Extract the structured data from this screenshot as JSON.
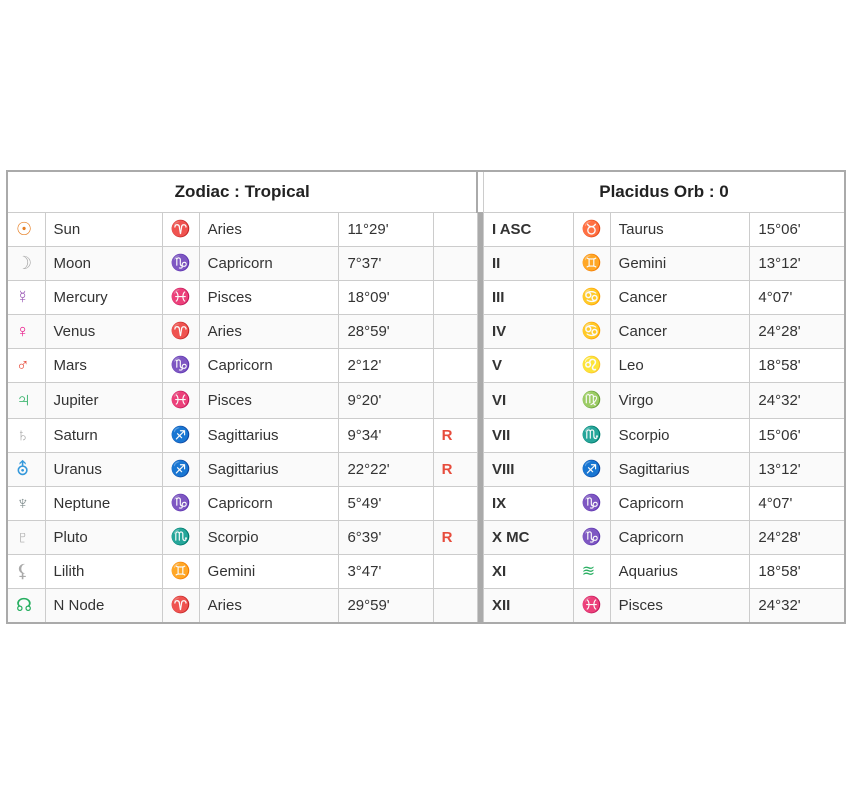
{
  "headers": {
    "left": "Zodiac : Tropical",
    "right": "Placidus Orb : 0"
  },
  "planets": [
    {
      "symbol": "☉",
      "sym_class": "sun-sym",
      "name": "Sun",
      "sign_sym": "♈",
      "sign_sym_class": "aries-sym",
      "sign": "Aries",
      "degree": "11°29'",
      "retro": ""
    },
    {
      "symbol": "☽",
      "sym_class": "moon-sym",
      "name": "Moon",
      "sign_sym": "♑",
      "sign_sym_class": "capricorn-sym",
      "sign": "Capricorn",
      "degree": "7°37'",
      "retro": ""
    },
    {
      "symbol": "☿",
      "sym_class": "mercury-sym",
      "name": "Mercury",
      "sign_sym": "♓",
      "sign_sym_class": "pisces-sym",
      "sign": "Pisces",
      "degree": "18°09'",
      "retro": ""
    },
    {
      "symbol": "♀",
      "sym_class": "venus-sym",
      "name": "Venus",
      "sign_sym": "♈",
      "sign_sym_class": "aries-sym",
      "sign": "Aries",
      "degree": "28°59'",
      "retro": ""
    },
    {
      "symbol": "♂",
      "sym_class": "mars-sym",
      "name": "Mars",
      "sign_sym": "♑",
      "sign_sym_class": "capricorn-sym",
      "sign": "Capricorn",
      "degree": "2°12'",
      "retro": ""
    },
    {
      "symbol": "♃",
      "sym_class": "jupiter-sym",
      "name": "Jupiter",
      "sign_sym": "♓",
      "sign_sym_class": "pisces-sym",
      "sign": "Pisces",
      "degree": "9°20'",
      "retro": ""
    },
    {
      "symbol": "♄",
      "sym_class": "saturn-sym",
      "name": "Saturn",
      "sign_sym": "♐",
      "sign_sym_class": "sagittarius-sym",
      "sign": "Sagittarius",
      "degree": "9°34'",
      "retro": "R"
    },
    {
      "symbol": "⛢",
      "sym_class": "uranus-sym",
      "name": "Uranus",
      "sign_sym": "♐",
      "sign_sym_class": "sagittarius-sym",
      "sign": "Sagittarius",
      "degree": "22°22'",
      "retro": "R"
    },
    {
      "symbol": "♆",
      "sym_class": "neptune-sym",
      "name": "Neptune",
      "sign_sym": "♑",
      "sign_sym_class": "capricorn-sym",
      "sign": "Capricorn",
      "degree": "5°49'",
      "retro": ""
    },
    {
      "symbol": "♇",
      "sym_class": "pluto-sym",
      "name": "Pluto",
      "sign_sym": "♏",
      "sign_sym_class": "scorpio-sym",
      "sign": "Scorpio",
      "degree": "6°39'",
      "retro": "R"
    },
    {
      "symbol": "⚸",
      "sym_class": "lilith-sym",
      "name": "Lilith",
      "sign_sym": "♊",
      "sign_sym_class": "gemini-sym",
      "sign": "Gemini",
      "degree": "3°47'",
      "retro": ""
    },
    {
      "symbol": "☊",
      "sym_class": "nnode-sym",
      "name": "N Node",
      "sign_sym": "♈",
      "sign_sym_class": "aries-sym",
      "sign": "Aries",
      "degree": "29°59'",
      "retro": ""
    }
  ],
  "houses": [
    {
      "house": "I ASC",
      "sign_sym": "♉",
      "sign_sym_class": "taurus-sym",
      "sign": "Taurus",
      "degree": "15°06'"
    },
    {
      "house": "II",
      "sign_sym": "♊",
      "sign_sym_class": "gemini-sym",
      "sign": "Gemini",
      "degree": "13°12'"
    },
    {
      "house": "III",
      "sign_sym": "♋",
      "sign_sym_class": "cancer-sym",
      "sign": "Cancer",
      "degree": "4°07'"
    },
    {
      "house": "IV",
      "sign_sym": "♋",
      "sign_sym_class": "cancer-sym",
      "sign": "Cancer",
      "degree": "24°28'"
    },
    {
      "house": "V",
      "sign_sym": "♌",
      "sign_sym_class": "leo-sym",
      "sign": "Leo",
      "degree": "18°58'"
    },
    {
      "house": "VI",
      "sign_sym": "♍",
      "sign_sym_class": "virgo-sym",
      "sign": "Virgo",
      "degree": "24°32'"
    },
    {
      "house": "VII",
      "sign_sym": "♏",
      "sign_sym_class": "scorpio-sym",
      "sign": "Scorpio",
      "degree": "15°06'"
    },
    {
      "house": "VIII",
      "sign_sym": "♐",
      "sign_sym_class": "sagittarius-sym",
      "sign": "Sagittarius",
      "degree": "13°12'"
    },
    {
      "house": "IX",
      "sign_sym": "♑",
      "sign_sym_class": "capricorn-sym",
      "sign": "Capricorn",
      "degree": "4°07'"
    },
    {
      "house": "X MC",
      "sign_sym": "♑",
      "sign_sym_class": "capricorn-sym",
      "sign": "Capricorn",
      "degree": "24°28'"
    },
    {
      "house": "XI",
      "sign_sym": "≋",
      "sign_sym_class": "aquarius-sym",
      "sign": "Aquarius",
      "degree": "18°58'"
    },
    {
      "house": "XII",
      "sign_sym": "♓",
      "sign_sym_class": "pisces-sym",
      "sign": "Pisces",
      "degree": "24°32'"
    }
  ]
}
